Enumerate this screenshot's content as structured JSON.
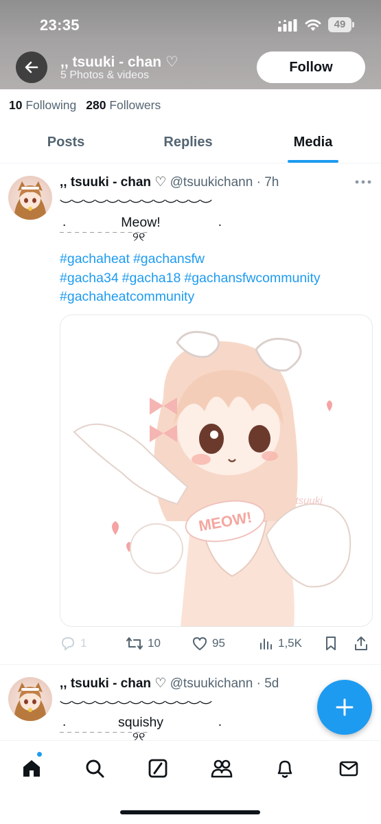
{
  "status_bar": {
    "time": "23:35",
    "battery": "49"
  },
  "header": {
    "name": ",, tsuuki - chan ♡",
    "subtitle": "5 Photos & videos",
    "follow_label": "Follow"
  },
  "stats": {
    "following_count": "10",
    "following_label": "Following",
    "followers_count": "280",
    "followers_label": "Followers"
  },
  "tabs": [
    {
      "label": "Posts",
      "active": false
    },
    {
      "label": "Replies",
      "active": false
    },
    {
      "label": "Media",
      "active": true
    }
  ],
  "posts": [
    {
      "author": ",, tsuuki - chan ♡",
      "meta": "@tsuukichann · 7h",
      "deco": "︶︶︶︶︶︶︶︶︶︶︶︶︶",
      "dot_left": ".",
      "caption": "Meow!",
      "dot_right": ".",
      "caption_dashes": "— — — — — —  — — — — — —",
      "caption_deco": "୨୧",
      "hashtags": [
        "#gachaheat",
        "#gachansfw",
        "#gacha34",
        "#gacha18",
        "#gachansfwcommunity",
        "#gachaheatcommunity"
      ],
      "media_texts": {
        "sticker": "MEOW!",
        "watermark": "tsuuki"
      },
      "replies": "1",
      "reposts": "10",
      "likes": "95",
      "views": "1,5K"
    },
    {
      "author": ",, tsuuki - chan ♡",
      "meta": "@tsuukichann · 5d",
      "deco": "︶︶︶︶︶︶︶︶︶︶︶︶︶",
      "dot_left": ".",
      "caption": "squishy",
      "dot_right": ".",
      "caption_dashes": "— — — — — —  — — — — — —",
      "caption_deco": "୨୧"
    }
  ],
  "icons": {
    "back": "arrow-left-icon",
    "more": "more-icon",
    "reply": "reply-icon",
    "repost": "repost-icon",
    "like": "heart-icon",
    "views": "views-icon",
    "bookmark": "bookmark-icon",
    "share": "share-icon",
    "compose": "plus-icon",
    "nav": [
      "home-icon",
      "search-icon",
      "grok-icon",
      "communities-icon",
      "notifications-icon",
      "messages-icon"
    ]
  },
  "colors": {
    "accent": "#1d9bf0",
    "text": "#0f1419",
    "muted": "#536471"
  }
}
